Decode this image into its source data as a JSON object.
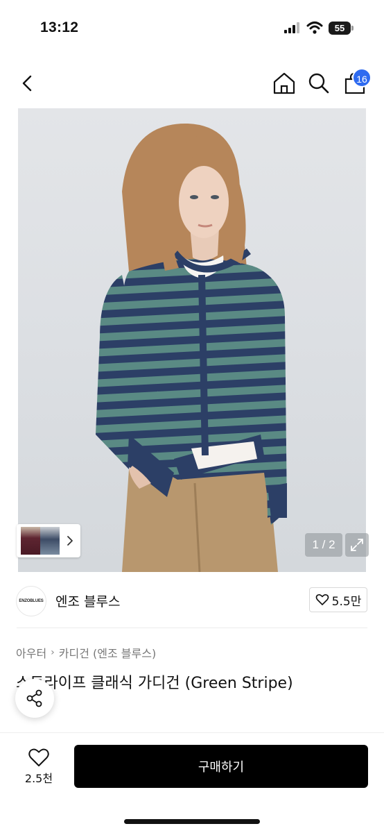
{
  "status_bar": {
    "time": "13:12",
    "battery": "55"
  },
  "nav": {
    "back_icon": "chevron-left-icon",
    "home_icon": "home-icon",
    "search_icon": "search-icon",
    "bag_icon": "shopping-bag-icon",
    "bag_badge": "16",
    "badge_color": "#2f6bf0"
  },
  "gallery": {
    "page_counter": "1 / 2",
    "current_page": 1,
    "total_pages": 2
  },
  "brand": {
    "logo_text": "ENZOBLUES",
    "name": "엔조 블루스",
    "like_count": "5.5만"
  },
  "product": {
    "breadcrumb": [
      "아우터",
      "카디건 (엔조 블루스)"
    ],
    "title": "스트라이프 클래식 가디건 (Green Stripe)"
  },
  "bottom_bar": {
    "wish_count": "2.5천",
    "buy_label": "구매하기",
    "buy_color": "#000000"
  }
}
